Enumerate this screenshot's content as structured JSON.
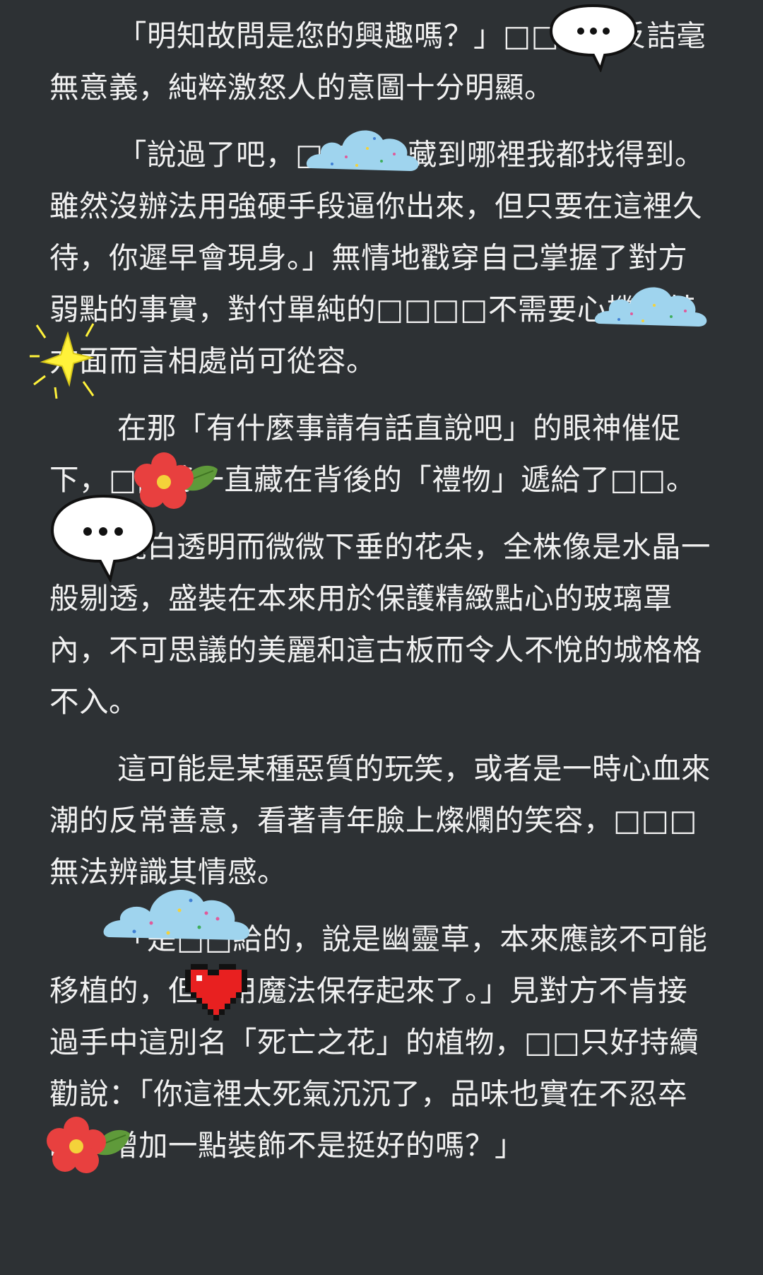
{
  "paragraphs": [
    "「明知故問是您的興趣嗎？」□□□的反詰毫無意義，純粹激怒人的意圖十分明顯。",
    "「說過了吧，□□□□藏到哪裡我都找得到。雖然沒辦法用強硬手段逼你出來，但只要在這裡久待，你遲早會現身。」無情地戳穿自己掌握了對方弱點的事實，對付單純的□□□□不需要心機，某方面而言相處尚可從容。",
    "在那「有什麼事請有話直說吧」的眼神催促下，□□將一直藏在背後的「禮物」遞給了□□。",
    "純白透明而微微下垂的花朵，全株像是水晶一般剔透，盛裝在本來用於保護精緻點心的玻璃罩內，不可思議的美麗和這古板而令人不悅的城格格不入。",
    "這可能是某種惡質的玩笑，或者是一時心血來潮的反常善意，看著青年臉上燦爛的笑容，□□□無法辨識其情感。",
    "「是□□給的，說是幽靈草，本來應該不可能移植的，但我用魔法保存起來了。」見對方不肯接過手中這別名「死亡之花」的植物，□□只好持續勸說：「你這裡太死氣沉沉了，品味也實在不忍卒睹，增加一點裝飾不是挺好的嗎？」"
  ],
  "stickers": {
    "speech_bubble_1": "speech-bubble-icon",
    "speech_bubble_2": "speech-bubble-icon",
    "cloud_1": "cloud-icon",
    "cloud_2": "cloud-icon",
    "cloud_3": "cloud-icon",
    "sparkle": "sparkle-icon",
    "flower_1": "flower-icon",
    "flower_2": "flower-icon",
    "heart": "pixel-heart-icon"
  },
  "colors": {
    "background": "#2d3134",
    "text": "#f1f1f1",
    "cloud": "#9fd4ee",
    "flower": "#e8403f",
    "leaf": "#5f9a3a",
    "heart": "#e82020",
    "sparkle": "#fff23a"
  }
}
